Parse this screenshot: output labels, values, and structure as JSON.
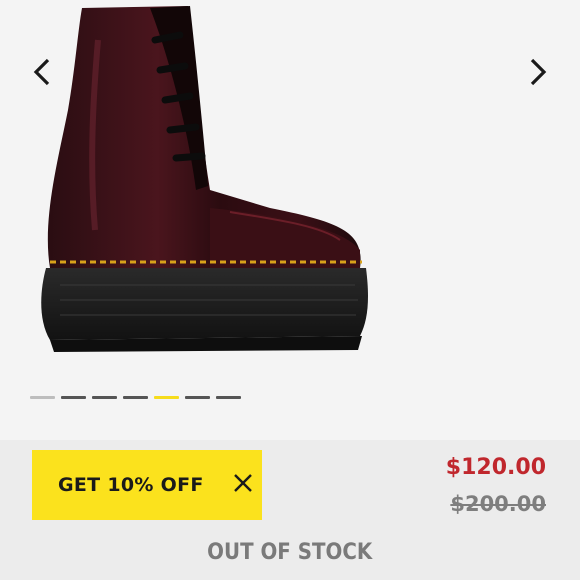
{
  "gallery": {
    "prev_icon": "chevron-left-icon",
    "next_icon": "chevron-right-icon",
    "image_subject": "boot-image",
    "dots": [
      {
        "state": "inactive"
      },
      {
        "state": "inactive"
      },
      {
        "state": "inactive"
      },
      {
        "state": "inactive"
      },
      {
        "state": "active"
      },
      {
        "state": "inactive"
      },
      {
        "state": "inactive"
      }
    ]
  },
  "promo": {
    "label": "GET 10% OFF",
    "close_icon": "close-icon",
    "background": "#fbe21d"
  },
  "pricing": {
    "price": "$120.00",
    "original_price": "$200.00",
    "price_color": "#c0272d"
  },
  "status": {
    "label": "OUT OF STOCK"
  }
}
